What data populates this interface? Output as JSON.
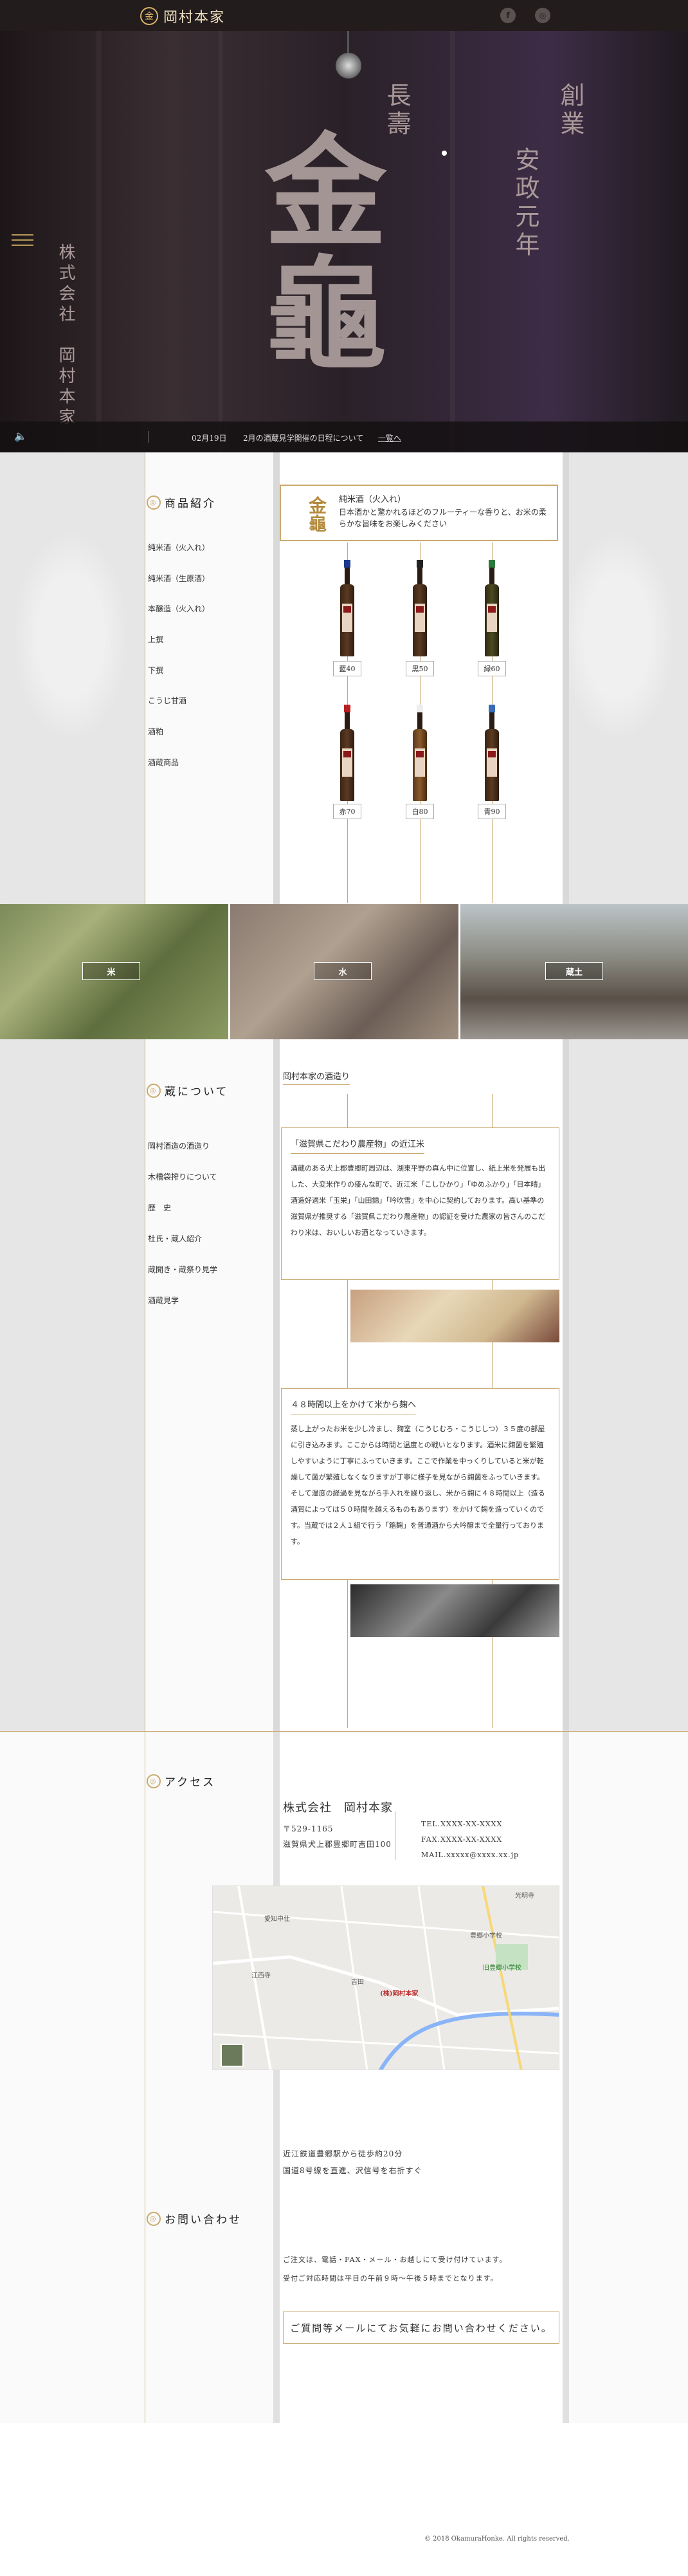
{
  "header": {
    "logo_mark": "金",
    "logo_text": "岡村本家",
    "sns": [
      {
        "icon": "facebook-icon",
        "glyph": "f"
      },
      {
        "icon": "instagram-icon",
        "glyph": "◎"
      }
    ]
  },
  "hero": {
    "left_vertical": "株式会社　岡村本家",
    "center_small": "長壽",
    "center_big": "金龜",
    "right_vertical_1": "創業",
    "right_vertical_2": "安政元年",
    "news_date": "02月19日",
    "news_title": "2月の酒蔵見学開催の日程について",
    "news_more": "一覧へ"
  },
  "products": {
    "section_title": "商品紹介",
    "menu": [
      "純米酒（火入れ）",
      "純米酒（生原酒）",
      "本醸造（火入れ）",
      "上撰",
      "下撰",
      "こうじ甘酒",
      "酒粕",
      "酒蔵商品"
    ],
    "card_logo": "金龜",
    "card_title": "純米酒（火入れ）",
    "card_desc": "日本酒かと驚かれるほどのフルーティーな香りと、お米の柔らかな旨味をお楽しみください",
    "tags": [
      "藍40",
      "黒50",
      "緑60",
      "赤70",
      "白80",
      "青90"
    ]
  },
  "photos": [
    "米",
    "水",
    "蔵土"
  ],
  "kura": {
    "section_title": "蔵について",
    "heading": "岡村本家の酒造り",
    "menu": [
      "岡村酒造の酒造り",
      "木槽袋搾りについて",
      "歴　史",
      "杜氏・蔵人紹介",
      "蔵開き・蔵祭り見学",
      "酒蔵見学"
    ],
    "box1_title": "「滋賀県こだわり農産物」の近江米",
    "box1_text": "酒蔵のある犬上郡豊郷町周辺は、湖東平野の真ん中に位置し、紙上米を発展も出した、大変米作りの盛んな町で、近江米「こしひかり」「ゆめふかり」「日本晴」酒造好適米「玉栄」「山田錦」「吟吹雪」を中心に契約しております。高い基準の滋賀県が推奨する「滋賀県こだわり農産物」の認証を受けた農家の皆さんのこだわり米は、おいしいお酒となっていきます。",
    "box2_title": "４８時間以上をかけて米から麹へ",
    "box2_text": "蒸し上がったお米を少し冷まし、麹室（こうじむろ・こうじしつ）３５度の部屋に引き込みます。ここからは時間と温度との戦いとなります。酒米に麹菌を繁殖しやすいように丁寧にふっていきます。ここで作業を中っくりしていると米が乾燥して菌が繁殖しなくなりますが丁寧に様子を見ながら麹菌をふっていきます。そして温度の経過を見ながら手入れを繰り返し、米から麹に４８時間以上（造る酒質によっては５０時間を越えるものもあります）をかけて麹を造っていくのです。当蔵では２人１組で行う「箱麹」を普通酒から大吟醸まで全量行っております。"
  },
  "access": {
    "section_title": "アクセス",
    "company": "株式会社　岡村本家",
    "zip": "〒529-1165",
    "address": "滋賀県犬上郡豊郷町吉田100",
    "tel": "TEL.XXXX-XX-XXXX",
    "fax": "FAX.XXXX-XX-XXXX",
    "mail": "MAIL.xxxxx@xxxx.xx.jp",
    "map_labels": [
      "愛知中仕",
      "江西寺",
      "吉田",
      "(株)岡村本家",
      "豊郷町役場",
      "光明寺",
      "豊郷小学校",
      "旧豊郷小学校",
      "豊郷町役場",
      "豊郷駅"
    ],
    "dir1": "近江鉄道豊郷駅から徒歩約20分",
    "dir2": "国道8号線を直進、沢信号を右折すぐ"
  },
  "contact": {
    "section_title": "お問い合わせ",
    "text1": "ご注文は、電話・FAX・メール・お越しにて受け付けています。",
    "text2": "受付ご対応時間は平日の午前９時〜午後５時までとなります。",
    "banner": "ご質問等メールにてお気軽にお問い合わせください。"
  },
  "footer": {
    "copyright": "© 2018 OkamuraHonke. All rights reserved."
  }
}
